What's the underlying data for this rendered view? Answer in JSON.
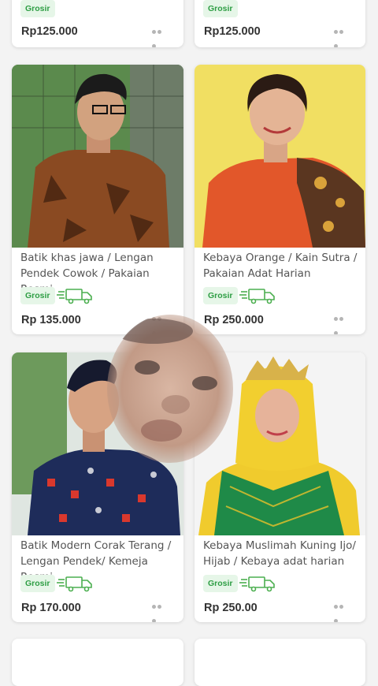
{
  "top_row": [
    {
      "badge": "Grosir",
      "price": "Rp125.000"
    },
    {
      "badge": "Grosir",
      "price": "Rp125.000"
    }
  ],
  "products": [
    {
      "title": "Batik khas jawa / Lengan Pendek Cowok / Pakaian Resmi",
      "badge": "Grosir",
      "price": "Rp 135.000",
      "bg": "#3f6e3b"
    },
    {
      "title": "Kebaya Orange / Kain Sutra / Pakaian Adat Harian",
      "badge": "Grosir",
      "price": "Rp 250.000",
      "bg": "#f1df62"
    },
    {
      "title": "Batik Modern Corak Terang / Lengan Pendek/ Kemeja Resmi",
      "badge": "Grosir",
      "price": "Rp 170.000",
      "bg": "#dfe6e1"
    },
    {
      "title": "Kebaya Muslimah Kuning Ijo/ Hijab / Kebaya adat harian",
      "badge": "Grosir",
      "price": "Rp 250.00",
      "bg": "#f4f4f4"
    }
  ],
  "icons": {
    "truck": "delivery-truck-icon",
    "more": "more-dots-icon"
  },
  "colors": {
    "badge_bg": "#e6f6e8",
    "badge_text": "#2e9e44",
    "price_text": "#333333"
  }
}
